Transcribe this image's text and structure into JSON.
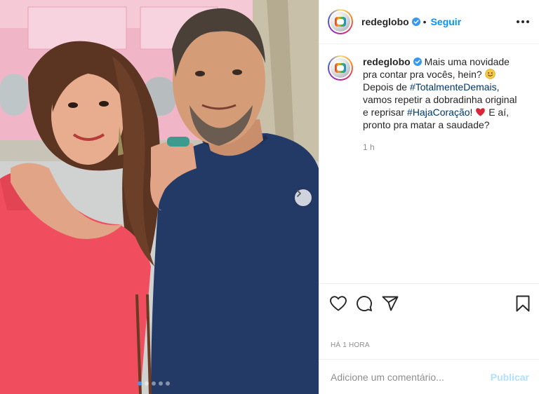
{
  "post": {
    "username": "redeglobo",
    "follow_label": "Seguir",
    "separator": "•",
    "caption_parts": {
      "p1": "Mais uma novidade pra contar pra vocês, hein?",
      "p2": "Depois de",
      "hashtag1": "#TotalmenteDemais",
      "p3": ", vamos repetir a dobradinha original e reprisar",
      "hashtag2": "#HajaCoração",
      "p4": "!",
      "p5": "E aí, pronto pra matar a saudade?"
    },
    "caption_time": "1 h",
    "posted_ago": "HÁ 1 HORA"
  },
  "comment": {
    "placeholder": "Adicione um comentário...",
    "publish_label": "Publicar"
  },
  "carousel": {
    "slide_count": 5,
    "active_index": 0
  },
  "colors": {
    "accent": "#0095f6",
    "verified": "#3897f0",
    "publish_disabled": "#b2dffc",
    "hashtag": "#00376b",
    "heart": "#ed4956"
  },
  "icons": [
    "verified-badge-icon",
    "more-options-icon",
    "heart-icon",
    "comment-icon",
    "share-icon",
    "bookmark-icon",
    "chevron-right-icon",
    "smile-emoji-icon",
    "red-heart-emoji-icon"
  ]
}
